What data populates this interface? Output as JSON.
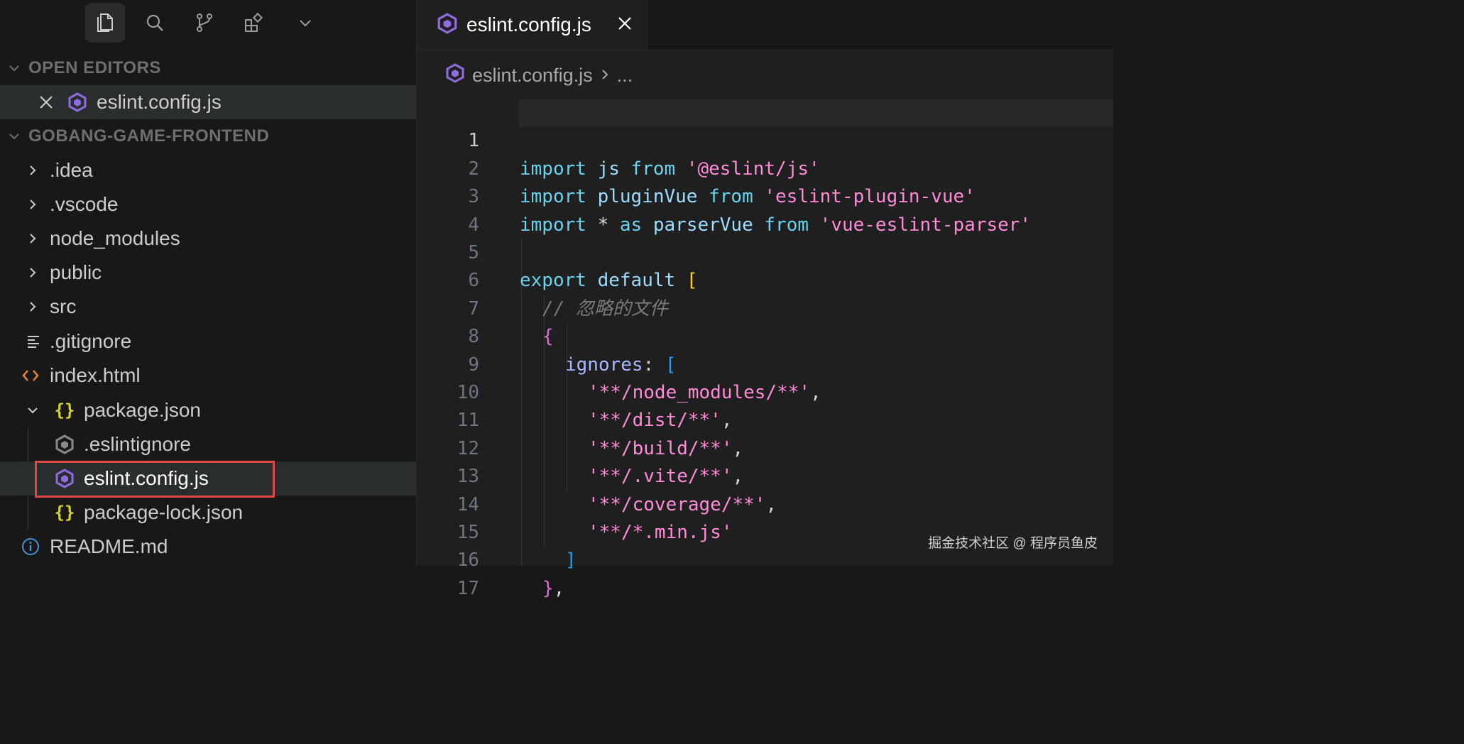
{
  "activity": {
    "icons": [
      "files-icon",
      "search-icon",
      "source-control-icon",
      "extensions-icon",
      "chevron-down-icon"
    ]
  },
  "open_editors": {
    "title": "OPEN EDITORS",
    "items": [
      {
        "label": "eslint.config.js"
      }
    ]
  },
  "explorer": {
    "title": "GOBANG-GAME-FRONTEND",
    "items": [
      {
        "label": ".idea",
        "type": "folder"
      },
      {
        "label": ".vscode",
        "type": "folder"
      },
      {
        "label": "node_modules",
        "type": "folder"
      },
      {
        "label": "public",
        "type": "folder"
      },
      {
        "label": "src",
        "type": "folder"
      },
      {
        "label": ".gitignore",
        "type": "file"
      },
      {
        "label": "index.html",
        "type": "file"
      },
      {
        "label": "package.json",
        "type": "expanded"
      },
      {
        "label": ".eslintignore",
        "type": "file"
      },
      {
        "label": "eslint.config.js",
        "type": "file"
      },
      {
        "label": "package-lock.json",
        "type": "file"
      },
      {
        "label": "README.md",
        "type": "file"
      }
    ]
  },
  "tab": {
    "label": "eslint.config.js"
  },
  "breadcrumb": {
    "file": "eslint.config.js",
    "more": "..."
  },
  "editor": {
    "line_numbers": [
      "1",
      "2",
      "3",
      "4",
      "5",
      "6",
      "7",
      "8",
      "9",
      "10",
      "11",
      "12",
      "13",
      "14",
      "15",
      "16",
      "17"
    ],
    "lines": {
      "l1": {
        "a": "import",
        "b": " js ",
        "c": "from",
        "d": " '@eslint/js'"
      },
      "l2": {
        "a": "import",
        "b": " pluginVue ",
        "c": "from",
        "d": " 'eslint-plugin-vue'"
      },
      "l3": {
        "a": "import",
        "b": " * ",
        "c": "as",
        "d": " parserVue ",
        "e": "from",
        "f": " 'vue-eslint-parser'"
      },
      "l5": {
        "a": "export",
        "b": " default ",
        "c": "["
      },
      "l6": {
        "a": "// 忽略的文件"
      },
      "l7": {
        "a": "{"
      },
      "l8": {
        "a": "ignores",
        "b": ": ",
        "c": "["
      },
      "l9": {
        "a": "'**/node_modules/**'",
        "b": ","
      },
      "l10": {
        "a": "'**/dist/**'",
        "b": ","
      },
      "l11": {
        "a": "'**/build/**'",
        "b": ","
      },
      "l12": {
        "a": "'**/.vite/**'",
        "b": ","
      },
      "l13": {
        "a": "'**/coverage/**'",
        "b": ","
      },
      "l14": {
        "a": "'**/*.min.js'"
      },
      "l15": {
        "a": "]"
      },
      "l16": {
        "a": "}",
        "b": ","
      }
    }
  },
  "watermark": "掘金技术社区 @ 程序员鱼皮",
  "colors": {
    "accent_highlight": "#e04848",
    "eslint_icon": "#8f6ce0",
    "json_icon": "#d7d32a",
    "html_icon": "#e8803a",
    "info_icon": "#4a90d9"
  }
}
